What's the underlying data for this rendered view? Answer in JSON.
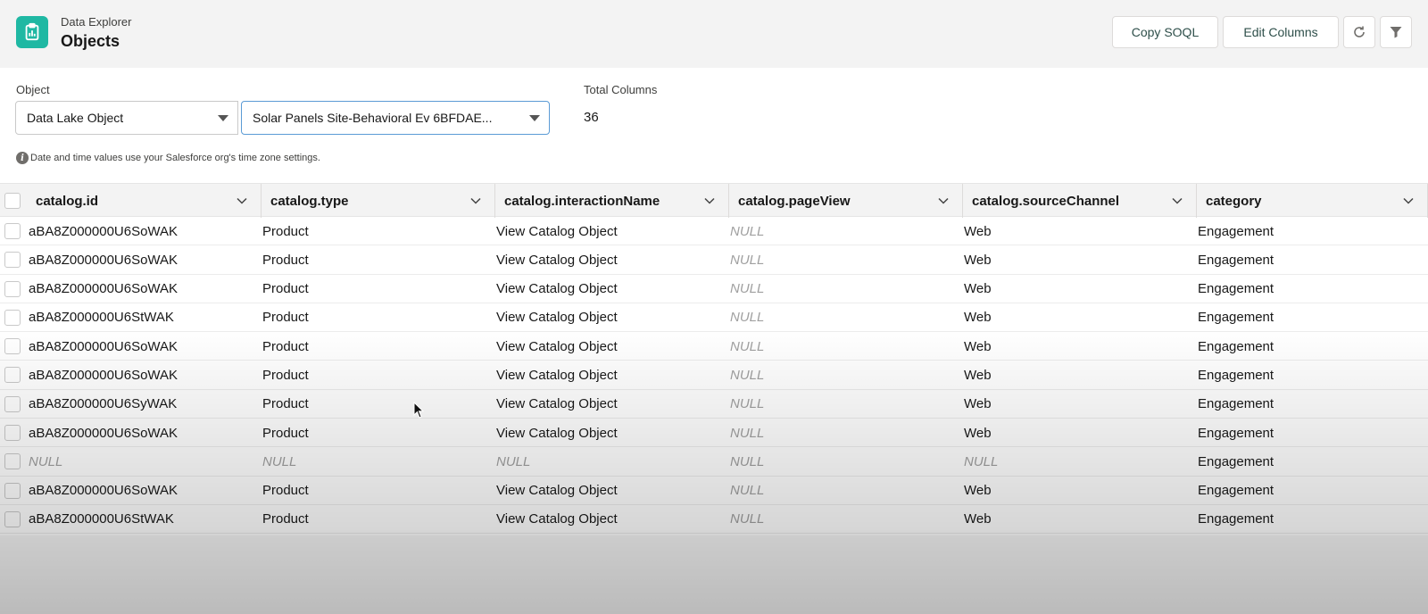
{
  "header": {
    "app_name": "Data Explorer",
    "page_title": "Objects",
    "copy_soql_label": "Copy SOQL",
    "edit_columns_label": "Edit Columns"
  },
  "icons": {
    "app": "chart-clipboard-icon",
    "refresh": "refresh-icon",
    "filter": "filter-icon",
    "info": "info-icon",
    "column_menu": "chevron-down-icon"
  },
  "colors": {
    "app_icon_bg": "#1fb8a3",
    "focused_border": "#5b9bd5",
    "null_text": "#a0a0a0"
  },
  "filters": {
    "object_label": "Object",
    "object_type_value": "Data Lake Object",
    "object_value": "Solar Panels Site-Behavioral Ev 6BFDAE...",
    "total_columns_label": "Total Columns",
    "total_columns_value": "36",
    "info_note": "Date and time values use your Salesforce org's time zone settings."
  },
  "table": {
    "columns": [
      "catalog.id",
      "catalog.type",
      "catalog.interactionName",
      "catalog.pageView",
      "catalog.sourceChannel",
      "category"
    ],
    "rows": [
      [
        "aBA8Z000000U6SoWAK",
        "Product",
        "View Catalog Object",
        "NULL",
        "Web",
        "Engagement"
      ],
      [
        "aBA8Z000000U6SoWAK",
        "Product",
        "View Catalog Object",
        "NULL",
        "Web",
        "Engagement"
      ],
      [
        "aBA8Z000000U6SoWAK",
        "Product",
        "View Catalog Object",
        "NULL",
        "Web",
        "Engagement"
      ],
      [
        "aBA8Z000000U6StWAK",
        "Product",
        "View Catalog Object",
        "NULL",
        "Web",
        "Engagement"
      ],
      [
        "aBA8Z000000U6SoWAK",
        "Product",
        "View Catalog Object",
        "NULL",
        "Web",
        "Engagement"
      ],
      [
        "aBA8Z000000U6SoWAK",
        "Product",
        "View Catalog Object",
        "NULL",
        "Web",
        "Engagement"
      ],
      [
        "aBA8Z000000U6SyWAK",
        "Product",
        "View Catalog Object",
        "NULL",
        "Web",
        "Engagement"
      ],
      [
        "aBA8Z000000U6SoWAK",
        "Product",
        "View Catalog Object",
        "NULL",
        "Web",
        "Engagement"
      ],
      [
        "NULL",
        "NULL",
        "NULL",
        "NULL",
        "NULL",
        "Engagement"
      ],
      [
        "aBA8Z000000U6SoWAK",
        "Product",
        "View Catalog Object",
        "NULL",
        "Web",
        "Engagement"
      ],
      [
        "aBA8Z000000U6StWAK",
        "Product",
        "View Catalog Object",
        "NULL",
        "Web",
        "Engagement"
      ]
    ]
  }
}
